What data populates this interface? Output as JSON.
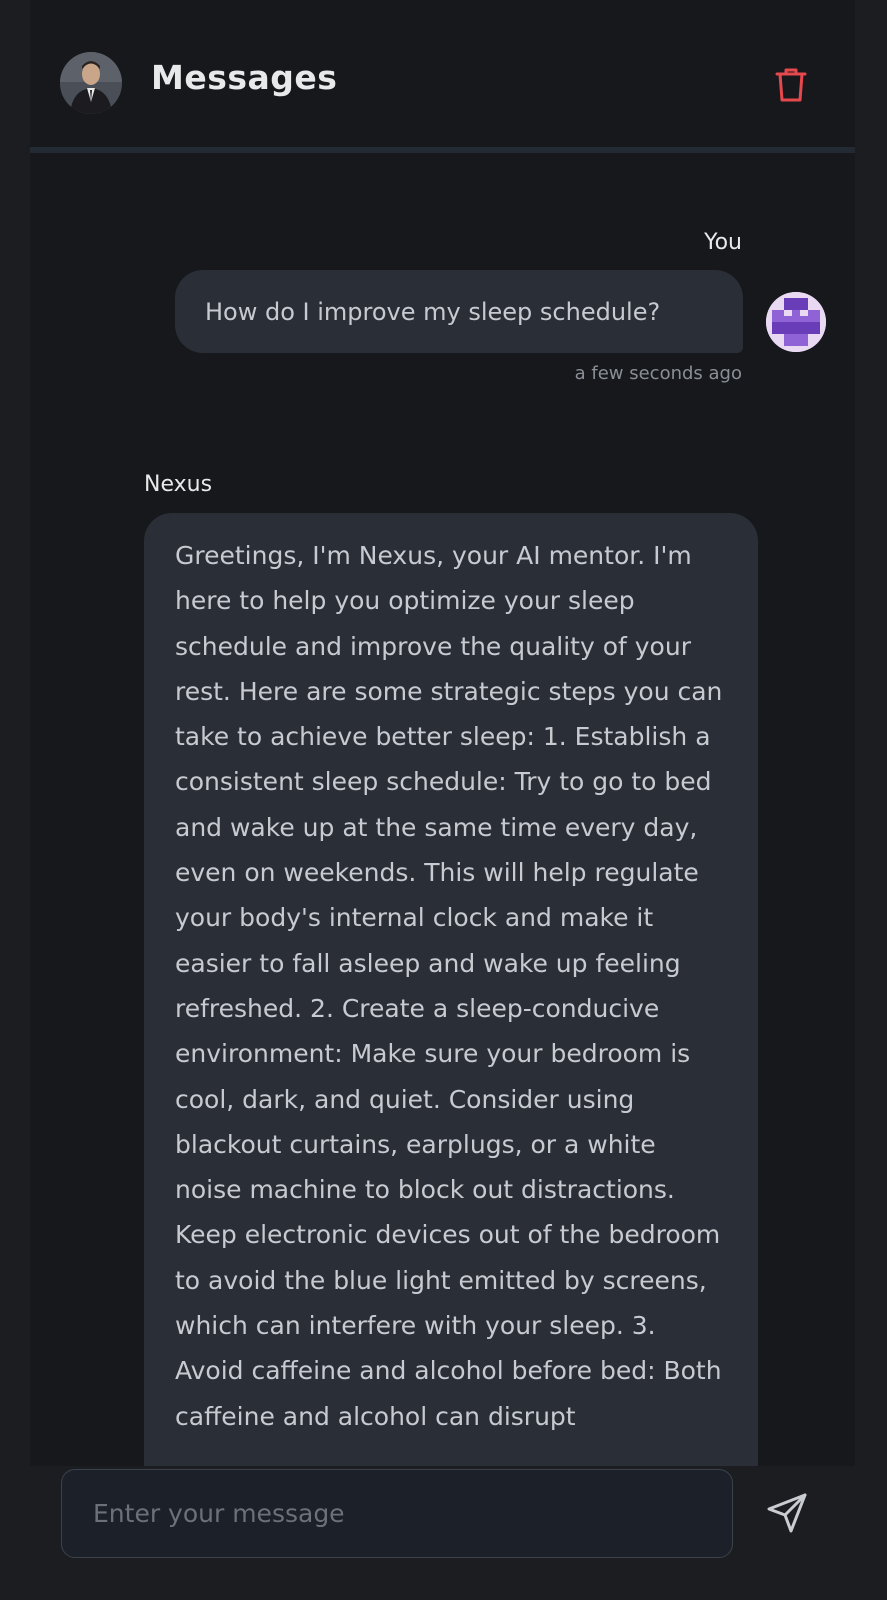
{
  "header": {
    "title": "Messages",
    "avatar_icon": "man-in-suit-avatar",
    "delete_icon": "trash-icon",
    "delete_color": "#e5484d"
  },
  "messages": [
    {
      "sender": "You",
      "text": "How do I improve my sleep schedule?",
      "timestamp": "a few seconds ago",
      "avatar_icon": "pixel-identicon-avatar",
      "avatar_color": "#6a3db8"
    },
    {
      "sender": "Nexus",
      "text": "Greetings, I'm Nexus, your AI mentor. I'm here to help you optimize your sleep schedule and improve the quality of your rest. Here are some strategic steps you can take to achieve better sleep: 1. Establish a consistent sleep schedule: Try to go to bed and wake up at the same time every day, even on weekends. This will help regulate your body's internal clock and make it easier to fall asleep and wake up feeling refreshed. 2. Create a sleep-conducive environment: Make sure your bedroom is cool, dark, and quiet. Consider using blackout curtains, earplugs, or a white noise machine to block out distractions. Keep electronic devices out of the bedroom to avoid the blue light emitted by screens, which can interfere with your sleep. 3. Avoid caffeine and alcohol before bed: Both caffeine and alcohol can disrupt"
    }
  ],
  "composer": {
    "placeholder": "Enter your message",
    "value": "",
    "send_icon": "send-icon"
  },
  "colors": {
    "background": "#16181c",
    "bubble": "#2a2f37",
    "text": "#c7cad0"
  }
}
